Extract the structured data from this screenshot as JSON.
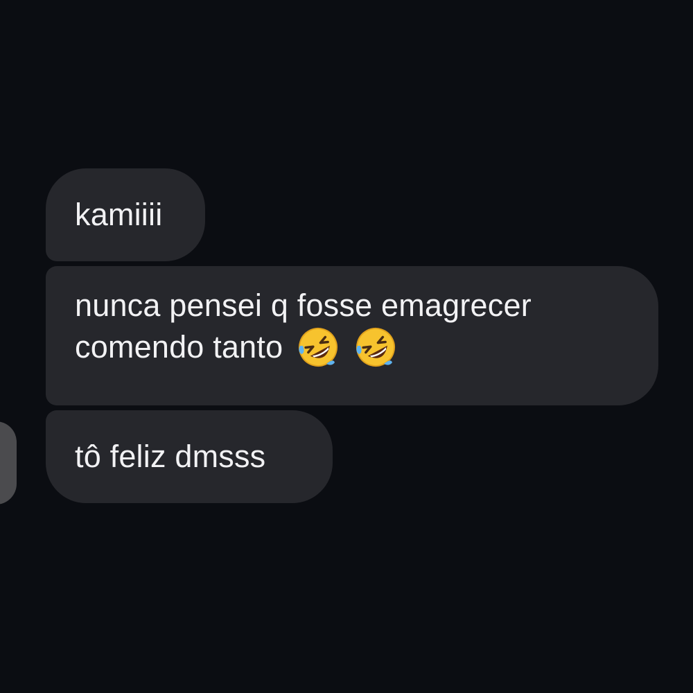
{
  "messages": [
    {
      "text": "kamiiii"
    },
    {
      "line1": "nunca pensei q fosse emagrecer",
      "line2": "comendo tanto",
      "emojis": [
        "rolling-on-floor-laughing-icon",
        "rolling-on-floor-laughing-icon"
      ]
    },
    {
      "text": "tô feliz dmsss"
    }
  ],
  "colors": {
    "background": "#0b0d12",
    "bubble": "#26272c",
    "text": "#f2f2f4",
    "avatar": "#4b4b4e"
  }
}
